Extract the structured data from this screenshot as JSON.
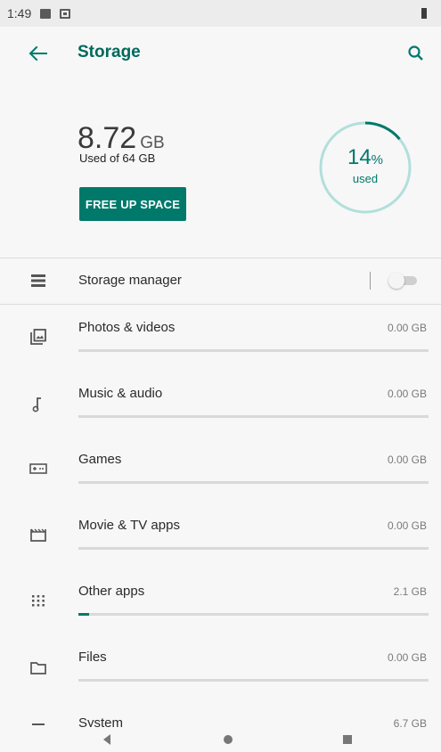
{
  "status_bar": {
    "time": "1:49"
  },
  "app_bar": {
    "title": "Storage"
  },
  "summary": {
    "used_value": "8.72",
    "used_unit": "GB",
    "used_of": "Used of 64 GB",
    "free_up_label": "FREE UP SPACE",
    "gauge_percent": "14",
    "gauge_percent_sign": "%",
    "gauge_used_label": "used",
    "gauge_fraction": 0.14
  },
  "storage_manager": {
    "label": "Storage manager",
    "enabled": false
  },
  "categories": [
    {
      "label": "Photos & videos",
      "size": "0.00 GB",
      "fraction": 0.0,
      "icon": "photos-icon"
    },
    {
      "label": "Music & audio",
      "size": "0.00 GB",
      "fraction": 0.0,
      "icon": "music-note-icon"
    },
    {
      "label": "Games",
      "size": "0.00 GB",
      "fraction": 0.0,
      "icon": "gamepad-icon"
    },
    {
      "label": "Movie & TV apps",
      "size": "0.00 GB",
      "fraction": 0.0,
      "icon": "movie-icon"
    },
    {
      "label": "Other apps",
      "size": "2.1 GB",
      "fraction": 0.03,
      "icon": "apps-grid-icon"
    },
    {
      "label": "Files",
      "size": "0.00 GB",
      "fraction": 0.0,
      "icon": "folder-icon"
    },
    {
      "label": "System",
      "size": "6.7 GB",
      "fraction": 0.1,
      "icon": "system-icon"
    }
  ],
  "colors": {
    "accent": "#00796b",
    "track": "#d9d9d9",
    "gauge_track": "#b2dfdb"
  }
}
